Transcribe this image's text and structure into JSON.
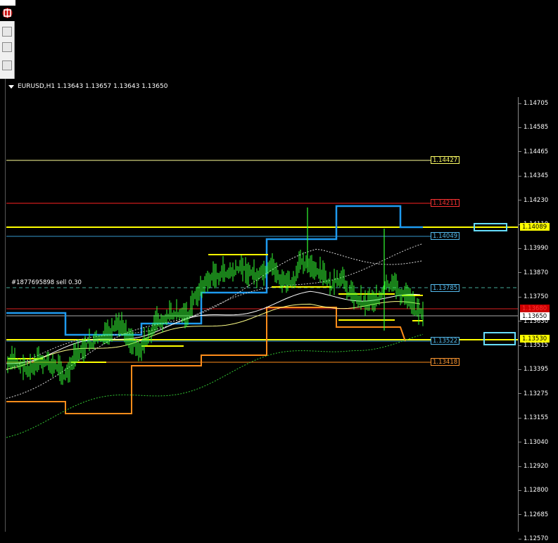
{
  "header": {
    "symbol_text": "EURUSD,H1  1.13643 1.13657 1.13643 1.13650"
  },
  "order_label": "#1877695898 sell 0.30",
  "price_scale": {
    "ticks": [
      "1.14705",
      "1.14585",
      "1.14465",
      "1.14345",
      "1.14230",
      "1.14110",
      "1.13990",
      "1.13870",
      "1.13750",
      "1.13630",
      "1.13515",
      "1.13395",
      "1.13275",
      "1.13155",
      "1.13040",
      "1.12920",
      "1.12800",
      "1.12685",
      "1.12570"
    ]
  },
  "level_tags": [
    {
      "text": "1.14427",
      "color": "#ffff66"
    },
    {
      "text": "1.14211",
      "color": "#ff3333"
    },
    {
      "text": "1.14049",
      "color": "#55bbee"
    },
    {
      "text": "1.13785",
      "color": "#55bbee"
    },
    {
      "text": "1.13522",
      "color": "#55bbee"
    },
    {
      "text": "1.13418",
      "color": "#ff9933"
    }
  ],
  "scale_tags": [
    {
      "text": "1.14089",
      "fg": "#000000",
      "bg": "#ffff00"
    },
    {
      "text": "1.13680",
      "fg": "#ff3333",
      "bg": "#cc0000"
    },
    {
      "text": "1.13650",
      "fg": "#000000",
      "bg": "#ffffff"
    },
    {
      "text": "1.13530",
      "fg": "#000000",
      "bg": "#ffff00"
    }
  ],
  "colors": {
    "candle": "#33ff33",
    "yellow": "#ffff00",
    "blue": "#1e9bf0",
    "orange": "#ff8c1a",
    "red": "#dd2222",
    "light_yellow": "#ffff99"
  },
  "icons": {
    "logo": "app-logo-icon",
    "symbol_menu": "dropdown-triangle-icon"
  }
}
